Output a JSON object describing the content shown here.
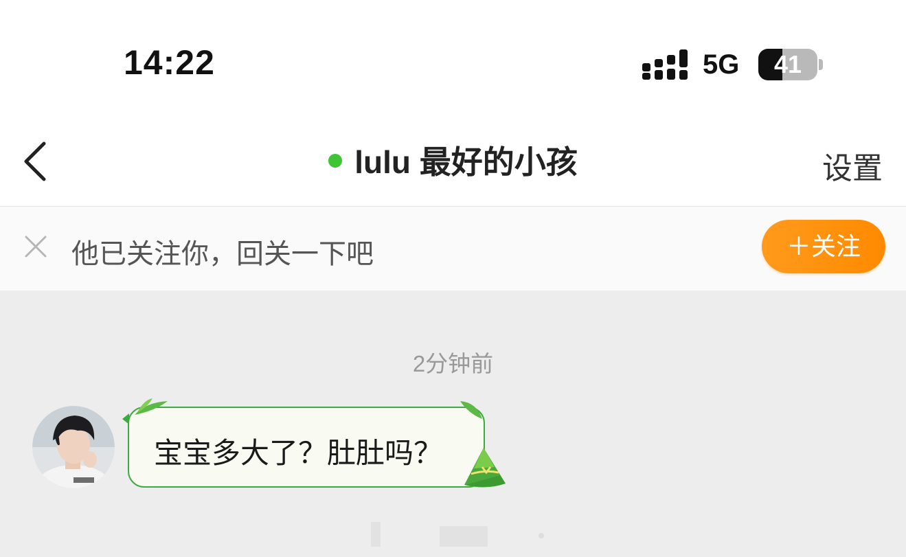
{
  "status_bar": {
    "time": "14:22",
    "network": "5G",
    "battery_level": "41",
    "battery_fraction": 0.41
  },
  "nav": {
    "title": "lulu 最好的小孩",
    "settings_label": "设置",
    "online_color": "#3ec435",
    "back_icon": "chevron-left-icon"
  },
  "follow_banner": {
    "text": "他已关注你，回关一下吧",
    "button_label": "＋关注",
    "close_icon": "close-icon",
    "accent": "#ff9000"
  },
  "chat": {
    "timestamp": "2分钟前",
    "messages": [
      {
        "sender": "other",
        "text": "宝宝多大了？肚肚吗？"
      }
    ],
    "bubble_border_color": "#3cab3f"
  }
}
